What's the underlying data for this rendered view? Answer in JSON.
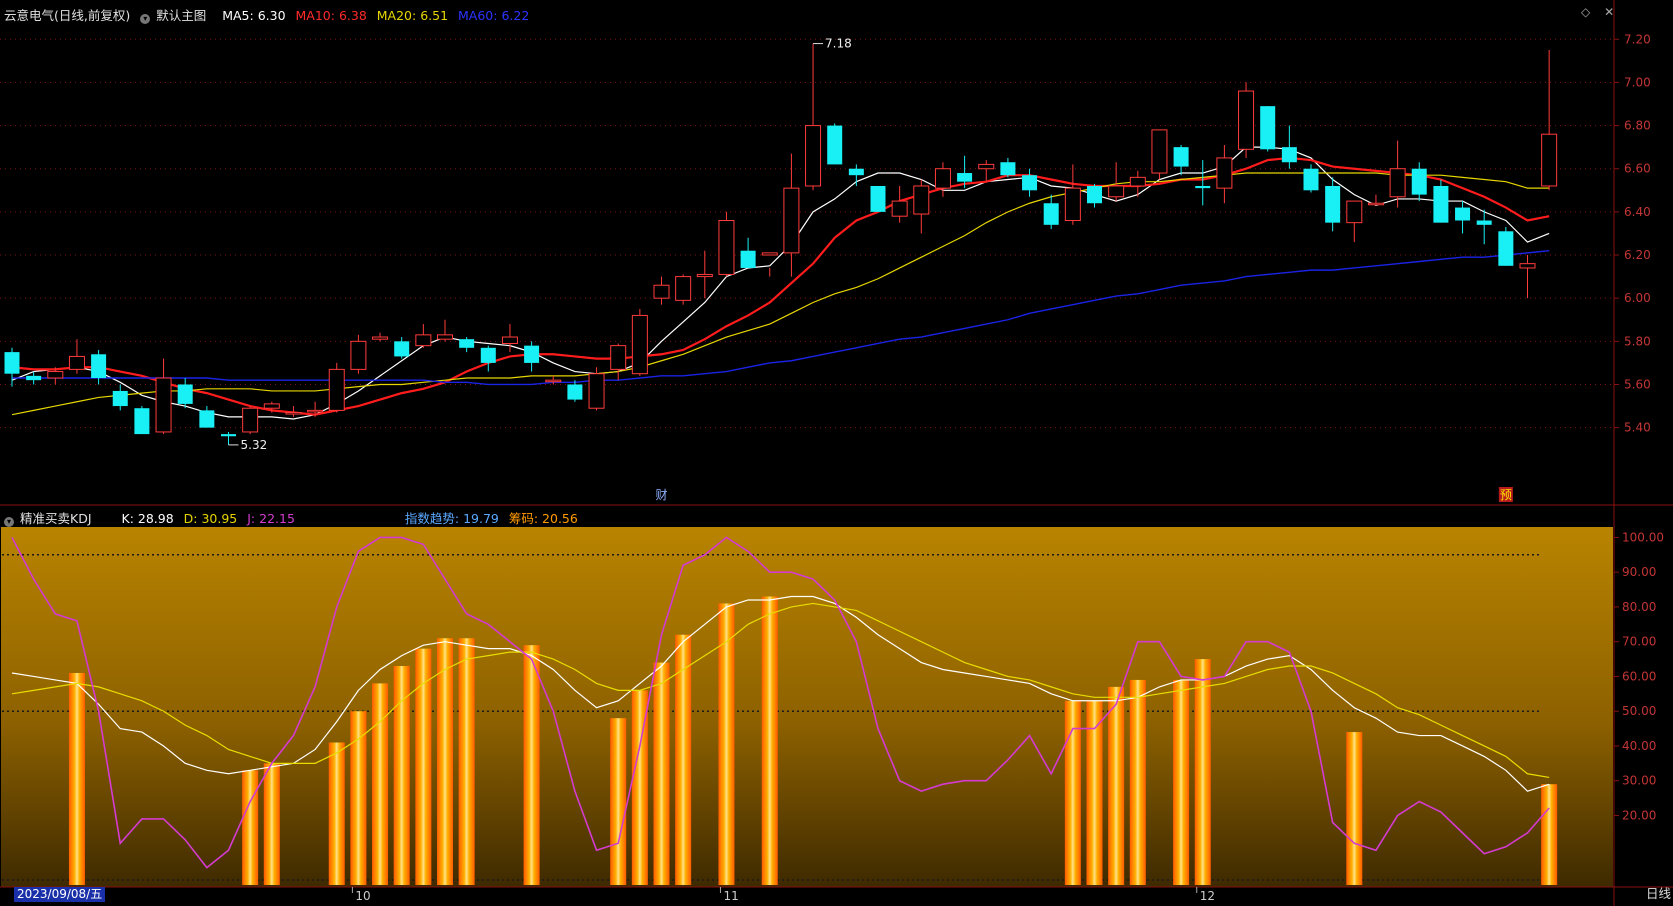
{
  "header": {
    "stock": "云意电气(日线,前复权)",
    "template": "默认主图",
    "ma5": "MA5: 6.30",
    "ma10": "MA10: 6.38",
    "ma20": "MA20: 6.51",
    "ma60": "MA60: 6.22"
  },
  "indicator": {
    "name": "精准买卖KDJ",
    "k": "K: 28.98",
    "d": "D: 30.95",
    "j": "J: 22.15",
    "trend": "指数趋势: 19.79",
    "chips": "筹码: 20.56"
  },
  "bottom": {
    "date": "2023/09/08/五",
    "period": "日线"
  },
  "colors": {
    "up": "#ff3b3b",
    "down": "#19f0f5",
    "ma5": "#ffffff",
    "ma10": "#ff1c1c",
    "ma20": "#e6d600",
    "ma60": "#1a23e6",
    "k": "#ffffff",
    "d": "#e8dd00",
    "j": "#d43bd0",
    "bars": "#ff6a00"
  },
  "chart_data": [
    {
      "type": "candlestick",
      "title": "云意电气(日线,前复权)",
      "ylim": [
        5.25,
        7.28
      ],
      "yticks": [
        "7.20",
        "7.00",
        "6.80",
        "6.60",
        "6.40",
        "6.20",
        "6.00",
        "5.80",
        "5.60",
        "5.40"
      ],
      "x_month_labels": [
        {
          "i": 16,
          "label": "10"
        },
        {
          "i": 33,
          "label": "11"
        },
        {
          "i": 55,
          "label": "12"
        }
      ],
      "annotations": [
        {
          "i": 37,
          "price": 7.18,
          "text": "7.18"
        },
        {
          "i": 10,
          "price": 5.32,
          "text": "5.32"
        }
      ],
      "event_markers": [
        {
          "i": 30,
          "text": "财"
        },
        {
          "i": 69,
          "text": "预"
        }
      ],
      "ohlc": [
        [
          5.75,
          5.77,
          5.59,
          5.65
        ],
        [
          5.64,
          5.66,
          5.6,
          5.62
        ],
        [
          5.63,
          5.68,
          5.6,
          5.66
        ],
        [
          5.67,
          5.81,
          5.65,
          5.73
        ],
        [
          5.74,
          5.76,
          5.6,
          5.63
        ],
        [
          5.57,
          5.6,
          5.48,
          5.5
        ],
        [
          5.49,
          5.5,
          5.38,
          5.37
        ],
        [
          5.38,
          5.72,
          5.37,
          5.63
        ],
        [
          5.6,
          5.63,
          5.49,
          5.51
        ],
        [
          5.48,
          5.5,
          5.4,
          5.4
        ],
        [
          5.37,
          5.38,
          5.32,
          5.36
        ],
        [
          5.38,
          5.5,
          5.37,
          5.49
        ],
        [
          5.49,
          5.52,
          5.47,
          5.51
        ],
        [
          5.47,
          5.5,
          5.45,
          5.47
        ],
        [
          5.48,
          5.52,
          5.45,
          5.48
        ],
        [
          5.48,
          5.7,
          5.47,
          5.67
        ],
        [
          5.67,
          5.83,
          5.65,
          5.8
        ],
        [
          5.81,
          5.84,
          5.8,
          5.82
        ],
        [
          5.8,
          5.82,
          5.72,
          5.73
        ],
        [
          5.78,
          5.88,
          5.77,
          5.83
        ],
        [
          5.81,
          5.9,
          5.8,
          5.83
        ],
        [
          5.81,
          5.82,
          5.75,
          5.77
        ],
        [
          5.77,
          5.78,
          5.66,
          5.7
        ],
        [
          5.79,
          5.88,
          5.75,
          5.82
        ],
        [
          5.78,
          5.8,
          5.66,
          5.7
        ],
        [
          5.62,
          5.64,
          5.6,
          5.62
        ],
        [
          5.6,
          5.62,
          5.52,
          5.53
        ],
        [
          5.49,
          5.68,
          5.48,
          5.65
        ],
        [
          5.67,
          5.79,
          5.62,
          5.78
        ],
        [
          5.65,
          5.95,
          5.64,
          5.92
        ],
        [
          6.0,
          6.1,
          5.97,
          6.06
        ],
        [
          5.99,
          6.11,
          5.97,
          6.1
        ],
        [
          6.1,
          6.22,
          6.0,
          6.11
        ],
        [
          6.11,
          6.4,
          6.1,
          6.36
        ],
        [
          6.22,
          6.28,
          6.18,
          6.14
        ],
        [
          6.2,
          6.14,
          6.1,
          6.21
        ],
        [
          6.21,
          6.67,
          6.1,
          6.51
        ],
        [
          6.52,
          7.18,
          6.5,
          6.8
        ],
        [
          6.8,
          6.81,
          6.64,
          6.62
        ],
        [
          6.6,
          6.62,
          6.52,
          6.57
        ],
        [
          6.52,
          6.51,
          6.4,
          6.4
        ],
        [
          6.38,
          6.52,
          6.35,
          6.45
        ],
        [
          6.39,
          6.55,
          6.3,
          6.52
        ],
        [
          6.51,
          6.63,
          6.47,
          6.6
        ],
        [
          6.58,
          6.66,
          6.51,
          6.54
        ],
        [
          6.6,
          6.64,
          6.54,
          6.62
        ],
        [
          6.63,
          6.65,
          6.56,
          6.57
        ],
        [
          6.57,
          6.6,
          6.47,
          6.5
        ],
        [
          6.44,
          6.48,
          6.32,
          6.34
        ],
        [
          6.36,
          6.62,
          6.34,
          6.51
        ],
        [
          6.52,
          6.53,
          6.42,
          6.44
        ],
        [
          6.47,
          6.63,
          6.45,
          6.52
        ],
        [
          6.52,
          6.59,
          6.47,
          6.56
        ],
        [
          6.58,
          6.72,
          6.55,
          6.78
        ],
        [
          6.7,
          6.71,
          6.57,
          6.61
        ],
        [
          6.52,
          6.64,
          6.43,
          6.51
        ],
        [
          6.51,
          6.71,
          6.44,
          6.65
        ],
        [
          6.69,
          7.0,
          6.65,
          6.96
        ],
        [
          6.89,
          6.89,
          6.68,
          6.69
        ],
        [
          6.7,
          6.8,
          6.6,
          6.63
        ],
        [
          6.6,
          6.62,
          6.49,
          6.5
        ],
        [
          6.52,
          6.56,
          6.31,
          6.35
        ],
        [
          6.35,
          6.37,
          6.26,
          6.45
        ],
        [
          6.44,
          6.48,
          6.43,
          6.44
        ],
        [
          6.47,
          6.73,
          6.42,
          6.6
        ],
        [
          6.6,
          6.63,
          6.45,
          6.48
        ],
        [
          6.52,
          6.55,
          6.35,
          6.35
        ],
        [
          6.42,
          6.45,
          6.3,
          6.36
        ],
        [
          6.36,
          6.41,
          6.25,
          6.34
        ],
        [
          6.31,
          6.33,
          6.15,
          6.15
        ],
        [
          6.14,
          6.2,
          6.0,
          6.16
        ],
        [
          6.52,
          7.15,
          6.5,
          6.76
        ]
      ],
      "series": [
        {
          "name": "MA5",
          "values": [
            5.62,
            5.66,
            5.67,
            5.68,
            5.66,
            5.61,
            5.55,
            5.52,
            5.5,
            5.47,
            5.45,
            5.45,
            5.45,
            5.44,
            5.46,
            5.51,
            5.57,
            5.64,
            5.71,
            5.78,
            5.82,
            5.8,
            5.79,
            5.78,
            5.75,
            5.7,
            5.66,
            5.65,
            5.66,
            5.7,
            5.8,
            5.89,
            5.98,
            6.1,
            6.14,
            6.15,
            6.25,
            6.4,
            6.46,
            6.54,
            6.58,
            6.58,
            6.55,
            6.5,
            6.5,
            6.54,
            6.55,
            6.56,
            6.52,
            6.51,
            6.48,
            6.45,
            6.48,
            6.55,
            6.58,
            6.58,
            6.61,
            6.7,
            6.7,
            6.69,
            6.65,
            6.55,
            6.48,
            6.43,
            6.46,
            6.46,
            6.45,
            6.45,
            6.4,
            6.36,
            6.26,
            6.3
          ]
        },
        {
          "name": "MA10",
          "values": [
            5.68,
            5.67,
            5.67,
            5.68,
            5.68,
            5.66,
            5.64,
            5.61,
            5.58,
            5.56,
            5.53,
            5.5,
            5.48,
            5.47,
            5.46,
            5.48,
            5.5,
            5.53,
            5.56,
            5.58,
            5.61,
            5.66,
            5.7,
            5.73,
            5.74,
            5.74,
            5.73,
            5.72,
            5.72,
            5.73,
            5.74,
            5.76,
            5.81,
            5.87,
            5.92,
            5.98,
            6.07,
            6.16,
            6.28,
            6.36,
            6.4,
            6.45,
            6.48,
            6.51,
            6.53,
            6.54,
            6.57,
            6.57,
            6.55,
            6.53,
            6.52,
            6.52,
            6.52,
            6.53,
            6.55,
            6.55,
            6.57,
            6.6,
            6.64,
            6.65,
            6.64,
            6.61,
            6.6,
            6.59,
            6.58,
            6.57,
            6.55,
            6.51,
            6.47,
            6.42,
            6.36,
            6.38
          ]
        },
        {
          "name": "MA20",
          "values": [
            5.46,
            5.48,
            5.5,
            5.52,
            5.54,
            5.55,
            5.56,
            5.57,
            5.57,
            5.58,
            5.58,
            5.58,
            5.57,
            5.57,
            5.57,
            5.58,
            5.59,
            5.6,
            5.6,
            5.61,
            5.62,
            5.63,
            5.63,
            5.63,
            5.64,
            5.64,
            5.64,
            5.65,
            5.66,
            5.68,
            5.71,
            5.74,
            5.78,
            5.82,
            5.85,
            5.88,
            5.93,
            5.98,
            6.02,
            6.05,
            6.09,
            6.14,
            6.19,
            6.24,
            6.29,
            6.35,
            6.4,
            6.44,
            6.47,
            6.49,
            6.51,
            6.53,
            6.54,
            6.54,
            6.55,
            6.56,
            6.57,
            6.58,
            6.58,
            6.58,
            6.58,
            6.58,
            6.58,
            6.58,
            6.57,
            6.57,
            6.57,
            6.56,
            6.55,
            6.54,
            6.51,
            6.51
          ]
        },
        {
          "name": "MA60",
          "values": [
            5.63,
            5.63,
            5.63,
            5.63,
            5.63,
            5.63,
            5.63,
            5.63,
            5.63,
            5.63,
            5.62,
            5.62,
            5.62,
            5.62,
            5.62,
            5.62,
            5.62,
            5.62,
            5.62,
            5.62,
            5.61,
            5.61,
            5.6,
            5.6,
            5.6,
            5.61,
            5.61,
            5.62,
            5.62,
            5.63,
            5.64,
            5.64,
            5.65,
            5.66,
            5.68,
            5.7,
            5.71,
            5.73,
            5.75,
            5.77,
            5.79,
            5.81,
            5.82,
            5.84,
            5.86,
            5.88,
            5.9,
            5.93,
            5.95,
            5.97,
            5.99,
            6.01,
            6.02,
            6.04,
            6.06,
            6.07,
            6.08,
            6.1,
            6.11,
            6.12,
            6.13,
            6.13,
            6.14,
            6.15,
            6.16,
            6.17,
            6.18,
            6.19,
            6.19,
            6.2,
            6.21,
            6.22
          ]
        }
      ]
    },
    {
      "type": "line",
      "title": "精准买卖KDJ",
      "ylim": [
        0,
        103
      ],
      "yticks": [
        "100.00",
        "90.00",
        "80.00",
        "70.00",
        "60.00",
        "50.00",
        "40.00",
        "30.00",
        "20.00"
      ],
      "reference_lines": [
        95,
        50,
        0
      ],
      "series": [
        {
          "name": "K",
          "values": [
            61,
            60,
            59,
            58,
            52,
            45,
            44,
            40,
            35,
            33,
            32,
            33,
            34,
            35,
            39,
            47,
            56,
            62,
            66,
            69,
            70,
            69,
            68,
            68,
            66,
            62,
            56,
            51,
            53,
            58,
            63,
            70,
            75,
            80,
            82,
            82,
            83,
            83,
            81,
            77,
            72,
            68,
            64,
            62,
            61,
            60,
            59,
            58,
            55,
            53,
            53,
            53,
            54,
            57,
            59,
            59,
            60,
            63,
            65,
            66,
            62,
            56,
            51,
            48,
            44,
            43,
            43,
            40,
            37,
            33,
            27,
            28.98
          ]
        },
        {
          "name": "D",
          "values": [
            55,
            56,
            57,
            58,
            57,
            55,
            53,
            50,
            46,
            43,
            39,
            37,
            35,
            35,
            35,
            38,
            42,
            47,
            53,
            58,
            62,
            65,
            66,
            67,
            67,
            65,
            62,
            58,
            56,
            56,
            58,
            62,
            66,
            70,
            75,
            78,
            80,
            81,
            80,
            79,
            76,
            73,
            70,
            67,
            64,
            62,
            60,
            59,
            57,
            55,
            54,
            54,
            54,
            55,
            56,
            57,
            58,
            60,
            62,
            63,
            63,
            61,
            58,
            55,
            51,
            49,
            46,
            43,
            40,
            37,
            32,
            30.95
          ]
        },
        {
          "name": "J",
          "values": [
            100,
            88,
            78,
            76,
            50,
            12,
            19,
            19,
            13,
            5,
            10,
            24,
            35,
            43,
            57,
            80,
            96,
            100,
            100,
            98,
            88,
            78,
            75,
            70,
            65,
            50,
            27,
            10,
            12,
            40,
            72,
            92,
            95,
            100,
            96,
            90,
            90,
            88,
            82,
            70,
            45,
            30,
            27,
            29,
            30,
            30,
            36,
            43,
            32,
            45,
            45,
            52,
            70,
            70,
            60,
            59,
            60,
            70,
            70,
            67,
            50,
            18,
            12,
            10,
            20,
            24,
            21,
            15,
            9,
            11,
            15,
            22.15
          ]
        },
        {
          "name": "bars",
          "values": [
            null,
            null,
            null,
            61,
            null,
            null,
            null,
            null,
            null,
            null,
            null,
            33,
            35,
            null,
            null,
            41,
            50,
            58,
            63,
            68,
            71,
            71,
            null,
            null,
            69,
            null,
            null,
            null,
            48,
            56,
            64,
            72,
            null,
            81,
            null,
            83,
            null,
            null,
            null,
            null,
            null,
            null,
            null,
            null,
            null,
            null,
            null,
            null,
            null,
            53,
            53,
            57,
            59,
            null,
            59,
            65,
            null,
            null,
            null,
            null,
            null,
            null,
            44,
            null,
            null,
            null,
            null,
            null,
            null,
            null,
            null,
            29
          ]
        }
      ]
    }
  ]
}
